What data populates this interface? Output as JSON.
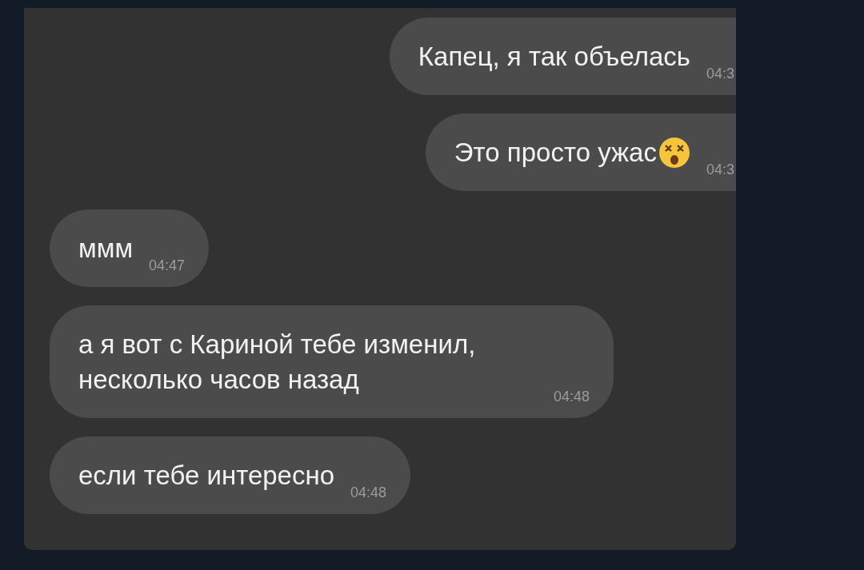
{
  "messages": [
    {
      "text": "Капец, я так объелась",
      "time": "04:3",
      "outgoing": true,
      "emoji": false
    },
    {
      "text": "Это просто ужас",
      "time": "04:3",
      "outgoing": true,
      "emoji": true
    },
    {
      "text": "ммм",
      "time": "04:47",
      "outgoing": false,
      "emoji": false
    },
    {
      "text": "а я вот с Кариной тебе изменил, несколько часов назад",
      "time": "04:48",
      "outgoing": false,
      "emoji": false
    },
    {
      "text": "если тебе интересно",
      "time": "04:48",
      "outgoing": false,
      "emoji": false
    }
  ]
}
